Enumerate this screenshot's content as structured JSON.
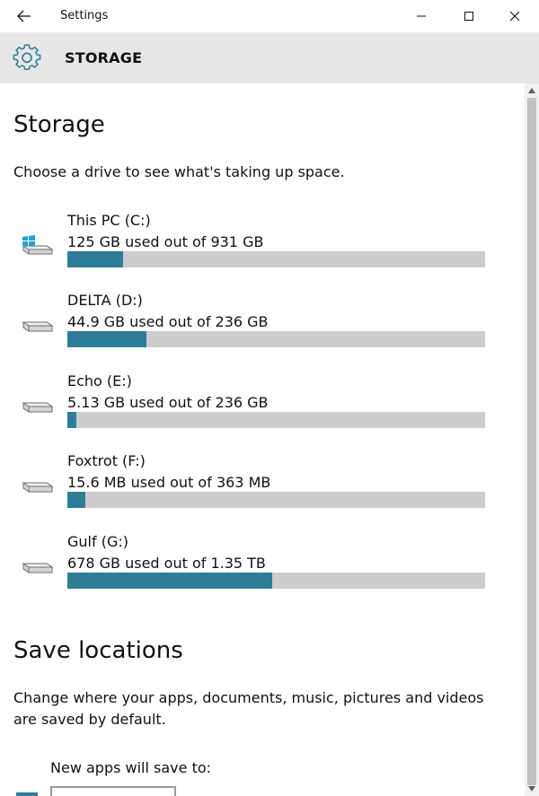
{
  "window": {
    "title": "Settings"
  },
  "header": {
    "title": "STORAGE",
    "icon": "gear-icon"
  },
  "storage": {
    "heading": "Storage",
    "description": "Choose a drive to see what's taking up space.",
    "drives": [
      {
        "name": "This PC (C:)",
        "usage": "125 GB used out of 931 GB",
        "used_fraction": 0.134,
        "icon": "windows-drive-icon"
      },
      {
        "name": "DELTA (D:)",
        "usage": "44.9 GB used out of 236 GB",
        "used_fraction": 0.19,
        "icon": "drive-icon"
      },
      {
        "name": "Echo (E:)",
        "usage": "5.13 GB used out of 236 GB",
        "used_fraction": 0.022,
        "icon": "drive-icon"
      },
      {
        "name": "Foxtrot (F:)",
        "usage": "15.6 MB used out of 363 MB",
        "used_fraction": 0.043,
        "icon": "drive-icon"
      },
      {
        "name": "Gulf (G:)",
        "usage": "678 GB used out of 1.35 TB",
        "used_fraction": 0.49,
        "icon": "drive-icon"
      }
    ]
  },
  "save_locations": {
    "heading": "Save locations",
    "description": "Change where your apps, documents, music, pictures and videos are saved by default.",
    "apps_label": "New apps will save to:"
  },
  "colors": {
    "accent": "#2d7d9a",
    "bar_background": "#cccccc",
    "header_background": "#e6e6e6"
  }
}
